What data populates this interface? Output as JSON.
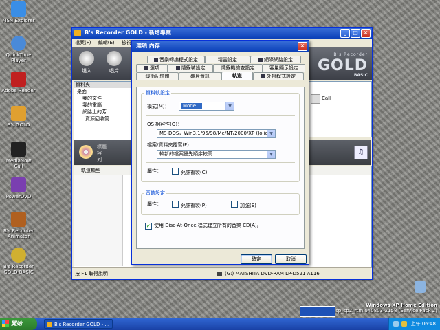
{
  "desktop": {
    "icons": [
      {
        "label": "MSN Explorer",
        "color": "#3a8ee6"
      },
      {
        "label": "QuickTime Player",
        "color": "#4a8ad8"
      },
      {
        "label": "Adobe Reader",
        "color": "#c02020"
      },
      {
        "label": "B's GOLD",
        "color": "#e0a030"
      },
      {
        "label": "MediaNow Call",
        "color": "#222222"
      },
      {
        "label": "PowerDVD",
        "color": "#7a3fb0"
      },
      {
        "label": "B's Recorder Animator",
        "color": "#b06020"
      },
      {
        "label": "B's Recorder GOLD BASIC",
        "color": "#d0b030"
      }
    ],
    "recycle_label": "資源回收筒",
    "os_label_1": "Windows XP Home Edition",
    "os_label_2": "Build 2600.xpsp_sp2_rtm.040803-2158 (Service Pack 2)"
  },
  "app": {
    "title": "B's Recorder GOLD - 新增專案",
    "menu": [
      "檔案(F)",
      "編輯(E)",
      "檢視(V)"
    ],
    "toolbar": [
      {
        "label": "燒入"
      },
      {
        "label": "唱片"
      }
    ],
    "brand": "GOLD",
    "brand_sub": "BASIC",
    "brand_top": "B's Recorder",
    "tree_header": "資料夾",
    "tree": [
      {
        "label": "桌面",
        "level": "root"
      },
      {
        "label": "我的文件",
        "level": "item"
      },
      {
        "label": "我的電腦",
        "level": "item"
      },
      {
        "label": "網路上的芳",
        "level": "item"
      },
      {
        "label": "資源回收筒",
        "level": "sub"
      }
    ],
    "mid_labels": [
      "標題",
      "容",
      "列"
    ],
    "track_header": "軌道類型",
    "right_label": "Call",
    "status_left": "按 F1 取得說明",
    "status_drive": "(G:) MATSHITA DVD-RAM LP-D521  A116"
  },
  "dialog": {
    "title": "選項 內存",
    "tabs_row1": [
      "音樂轉換程式設定",
      "精靈設定",
      "網際網路設定"
    ],
    "tabs_row2": [
      "選項",
      "燒錄裝設定",
      "燒錄機檢查設定",
      "容量顯示設定"
    ],
    "tabs_row3": [
      "緩衝記憶體",
      "碼片資訊",
      "軌道",
      "外掛程式設定"
    ],
    "active_tab": "軌道",
    "data_track_group": "資料軌設定",
    "mode_label": "模式(M)：",
    "mode_value": "Mode 1",
    "os_compat_label": "OS 相容性(O)：",
    "os_compat_value": "MS-DOS，Win3.1/95/98/Me/NT/2000/XP (Joliet)",
    "overwrite_label": "檔案/資料夾覆寫(F)",
    "overwrite_value": "較新的檔案優先順序較高",
    "attr_label": "屬性：",
    "allow_copy_1": "允許複製(C)",
    "audio_group": "音軌設定",
    "attr_label_2": "屬性：",
    "allow_copy_2": "允許複製(P)",
    "emphasis": "加強(E)",
    "dao_label": "使用 Disc-At-Once 模式建立所有的音樂 CD(A)。",
    "dao_checked": true,
    "ok": "確定",
    "cancel": "取消"
  },
  "taskbar": {
    "start": "開始",
    "task": "B's Recorder GOLD - ...",
    "clock": "上午 06:48"
  }
}
